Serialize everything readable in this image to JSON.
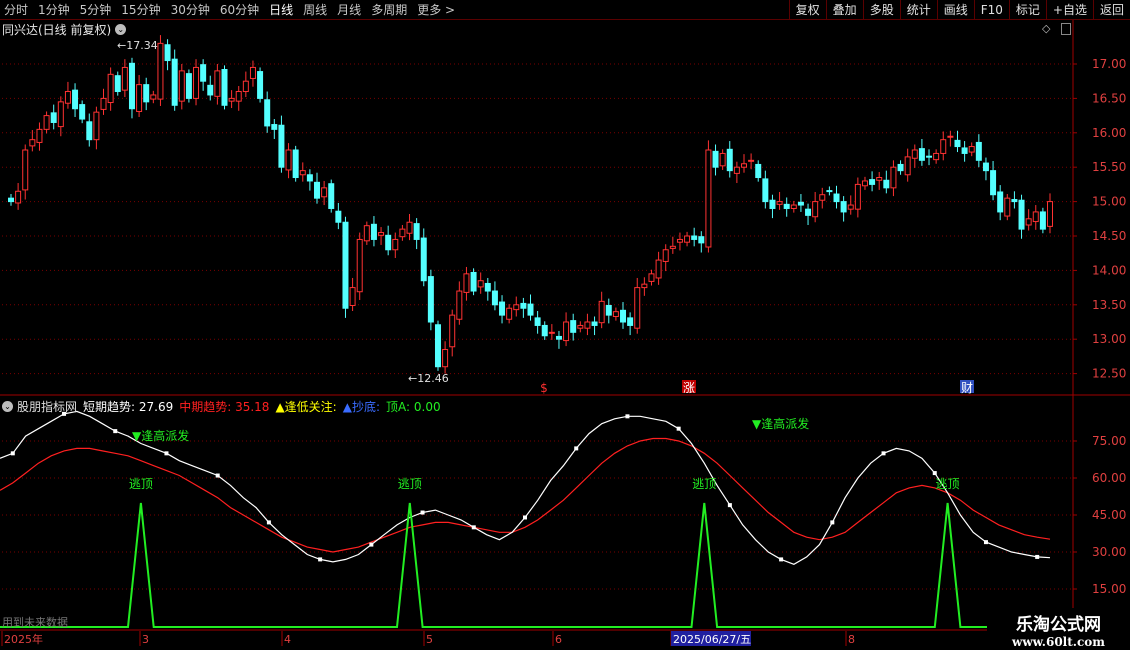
{
  "toolbar": {
    "timeframes": [
      "分时",
      "1分钟",
      "5分钟",
      "15分钟",
      "30分钟",
      "60分钟",
      "日线",
      "周线",
      "月线",
      "多周期",
      "更多 >"
    ],
    "active_timeframe": "日线",
    "right_buttons": [
      "复权",
      "叠加",
      "多股",
      "统计",
      "画线",
      "F10",
      "标记",
      "+自选",
      "返回"
    ]
  },
  "main_chart": {
    "title": "同兴达(日线 前复权)",
    "max_label": "17.34",
    "min_label": "12.46",
    "price_ticks": [
      "17.00",
      "16.50",
      "16.00",
      "15.50",
      "15.00",
      "14.50",
      "14.00",
      "13.50",
      "13.00",
      "12.50"
    ],
    "event_markers": [
      "$",
      "涨",
      "财"
    ],
    "colors": {
      "up": "#ff3232",
      "down": "#54ffff",
      "grid": "#7a0000"
    }
  },
  "indicator": {
    "name": "股朋指标网",
    "short_label": "短期趋势: 27.69",
    "mid_label": "中期趋势: 35.18",
    "low_focus": "▲逢低关注:",
    "bottom_buy": "▲抄底:",
    "top_a": "顶A: 0.00",
    "ticks": [
      "75.00",
      "60.00",
      "45.00",
      "30.00",
      "15.00"
    ],
    "sell_high_label": "▼逢高派发",
    "escape_label": "逃顶",
    "future_note": "用到未来数据",
    "colors": {
      "short": "#ffffff",
      "mid": "#ff2020",
      "signal": "#22ee22"
    }
  },
  "date_axis": {
    "labels": [
      "2025年",
      "3",
      "4",
      "5",
      "6",
      "2025/06/27/五",
      "8"
    ]
  },
  "watermark": {
    "line1": "乐淘公式网",
    "line2": "www.60lt.com"
  },
  "chart_data": [
    {
      "type": "candlestick",
      "title": "同兴达(日线 前复权)",
      "ylim": [
        12.3,
        17.6
      ],
      "max": 17.34,
      "min": 12.46,
      "close": [
        15.0,
        15.15,
        15.75,
        15.9,
        16.05,
        16.25,
        16.15,
        16.45,
        16.6,
        16.35,
        16.2,
        15.9,
        16.3,
        16.5,
        16.85,
        16.6,
        16.95,
        16.35,
        16.7,
        16.45,
        16.55,
        17.3,
        17.05,
        16.4,
        16.9,
        16.5,
        16.95,
        16.75,
        16.55,
        16.9,
        16.4,
        16.5,
        16.6,
        16.75,
        16.95,
        16.5,
        16.1,
        16.05,
        15.5,
        15.75,
        15.35,
        15.45,
        15.3,
        15.05,
        15.2,
        14.9,
        14.7,
        13.45,
        13.75,
        14.45,
        14.65,
        14.45,
        14.55,
        14.3,
        14.45,
        14.6,
        14.7,
        14.45,
        13.85,
        13.25,
        12.6,
        12.85,
        13.35,
        13.7,
        13.95,
        13.7,
        13.85,
        13.7,
        13.5,
        13.35,
        13.45,
        13.5,
        13.45,
        13.35,
        13.2,
        13.05,
        13.1,
        13.0,
        13.25,
        13.1,
        13.2,
        13.25,
        13.2,
        13.55,
        13.35,
        13.4,
        13.25,
        13.2,
        13.75,
        13.8,
        13.95,
        14.15,
        14.3,
        14.35,
        14.45,
        14.5,
        14.45,
        14.4,
        15.75,
        15.5,
        15.7,
        15.45,
        15.5,
        15.55,
        15.6,
        15.35,
        15.0,
        14.9,
        15.0,
        14.9,
        14.95,
        14.95,
        14.8,
        15.0,
        15.1,
        15.15,
        15.0,
        14.85,
        14.95,
        15.25,
        15.3,
        15.25,
        15.35,
        15.2,
        15.5,
        15.45,
        15.65,
        15.75,
        15.6,
        15.65,
        15.7,
        15.9,
        15.95,
        15.8,
        15.7,
        15.8,
        15.6,
        15.45,
        15.1,
        14.85,
        15.05,
        15.0,
        14.6,
        14.75,
        14.85,
        14.6,
        15.0
      ]
    },
    {
      "type": "line",
      "title": "股朋指标网",
      "ylim": [
        8,
        100
      ],
      "series": [
        {
          "name": "短期趋势",
          "values": [
            68,
            70,
            77,
            80,
            83,
            86,
            87,
            85,
            82,
            79,
            77,
            74,
            72,
            70,
            67,
            65,
            63,
            61,
            57,
            52,
            48,
            42,
            37,
            33,
            29,
            27,
            26,
            27,
            29,
            33,
            37,
            41,
            44,
            46,
            47,
            45,
            43,
            40,
            37,
            35,
            38,
            44,
            51,
            59,
            65,
            72,
            78,
            82,
            84,
            85,
            85,
            84,
            83,
            80,
            74,
            66,
            57,
            49,
            41,
            35,
            30,
            27,
            25,
            28,
            33,
            42,
            52,
            60,
            66,
            70,
            72,
            71,
            68,
            62,
            54,
            45,
            38,
            34,
            32,
            30,
            29,
            28,
            27.7
          ]
        },
        {
          "name": "中期趋势",
          "values": [
            55,
            58,
            62,
            66,
            69,
            71,
            72,
            72,
            71,
            70,
            69,
            67,
            65,
            63,
            61,
            58,
            55,
            52,
            48,
            45,
            42,
            39,
            36,
            34,
            32,
            31,
            30,
            31,
            32,
            34,
            36,
            38,
            40,
            41,
            42,
            42,
            41,
            40,
            39,
            38,
            38,
            40,
            43,
            47,
            51,
            56,
            61,
            66,
            70,
            73,
            75,
            76,
            76,
            75,
            73,
            70,
            66,
            61,
            56,
            51,
            46,
            42,
            38,
            36,
            35,
            36,
            38,
            42,
            46,
            50,
            54,
            56,
            57,
            56,
            54,
            51,
            47,
            44,
            41,
            39,
            37,
            36,
            35.2
          ]
        },
        {
          "name": "逃顶",
          "values": [
            0,
            0,
            0,
            0,
            0,
            0,
            0,
            0,
            0,
            0,
            0,
            50,
            0,
            0,
            0,
            0,
            0,
            0,
            0,
            0,
            0,
            0,
            0,
            0,
            0,
            0,
            0,
            0,
            0,
            0,
            0,
            0,
            50,
            0,
            0,
            0,
            0,
            0,
            0,
            0,
            0,
            0,
            0,
            0,
            0,
            0,
            0,
            0,
            0,
            0,
            0,
            0,
            0,
            0,
            0,
            50,
            0,
            0,
            0,
            0,
            0,
            0,
            0,
            0,
            0,
            0,
            0,
            0,
            0,
            0,
            0,
            0,
            0,
            0,
            50,
            0,
            0,
            0,
            0,
            0,
            0,
            0,
            0
          ]
        }
      ]
    }
  ]
}
